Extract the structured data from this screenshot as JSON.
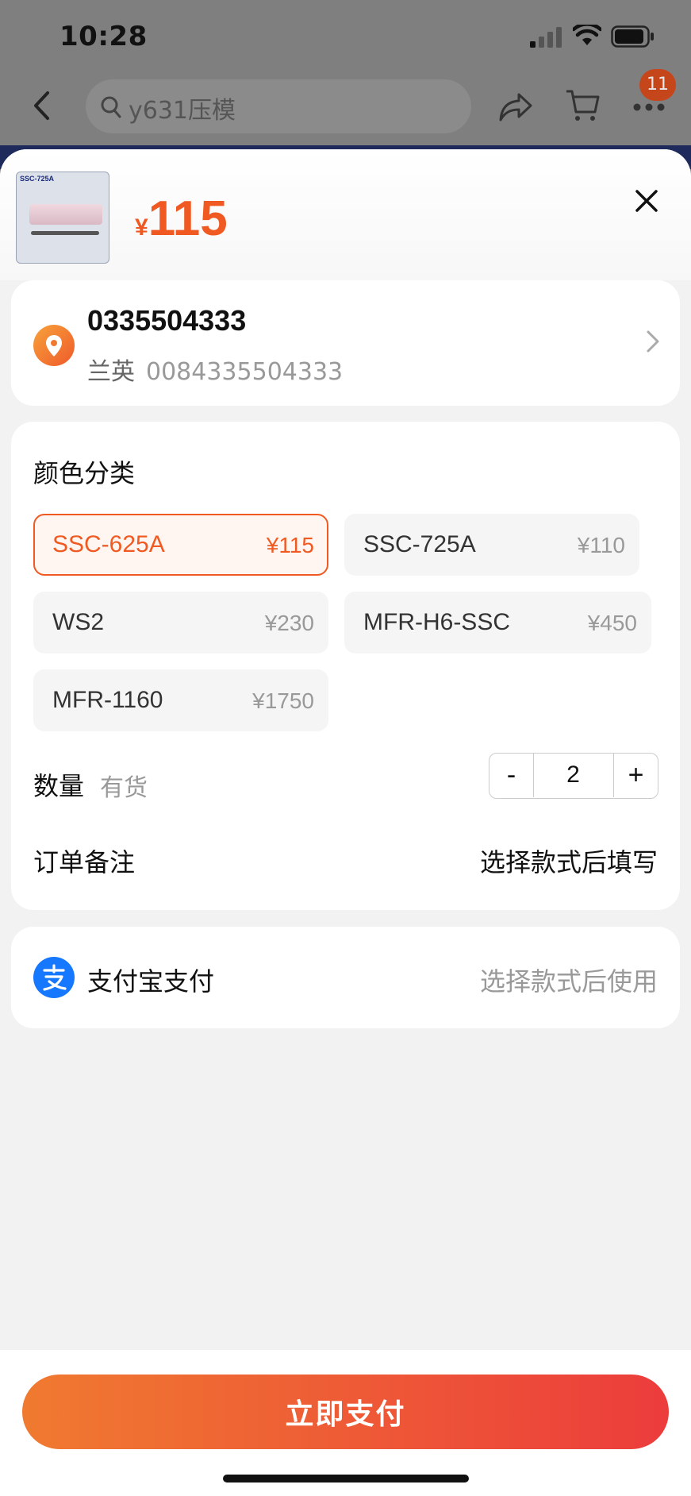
{
  "status_bar": {
    "time": "10:28"
  },
  "nav": {
    "search_text": "y631压模",
    "badge_count": "11"
  },
  "product": {
    "thumb_label": "SSC-725A",
    "price_symbol": "¥",
    "price": "115"
  },
  "address": {
    "phone": "0335504333",
    "name": "兰英",
    "number": "0084335504333"
  },
  "options": {
    "title": "颜色分类",
    "items": [
      {
        "name": "SSC-625A",
        "price": "¥115",
        "selected": true
      },
      {
        "name": "SSC-725A",
        "price": "¥110",
        "selected": false
      },
      {
        "name": "WS2",
        "price": "¥230",
        "selected": false
      },
      {
        "name": "MFR-H6-SSC",
        "price": "¥450",
        "selected": false
      },
      {
        "name": "MFR-1160",
        "price": "¥1750",
        "selected": false
      }
    ]
  },
  "quantity": {
    "label": "数量",
    "stock": "有货",
    "minus": "-",
    "value": "2",
    "plus": "+"
  },
  "note": {
    "label": "订单备注",
    "action": "选择款式后填写"
  },
  "payment": {
    "label": "支付宝支付",
    "hint": "选择款式后使用"
  },
  "footer": {
    "pay_button": "立即支付"
  },
  "colors": {
    "accent": "#f05a22",
    "button_start": "#f07a30",
    "button_end": "#ec3c3c",
    "alipay": "#1677ff"
  }
}
